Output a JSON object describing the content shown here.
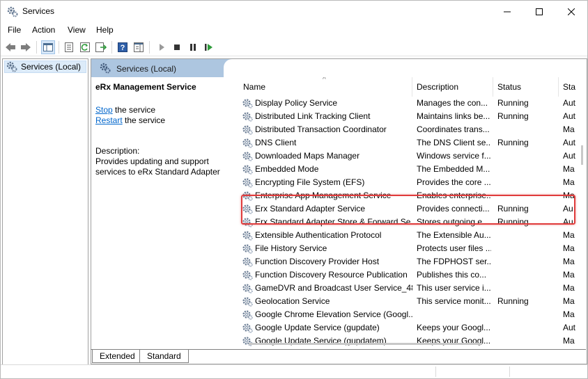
{
  "window": {
    "title": "Services"
  },
  "menu": [
    "File",
    "Action",
    "View",
    "Help"
  ],
  "toolbar": {
    "icons": [
      "back-arrow-icon",
      "forward-arrow-icon",
      "show-hide-console-tree-icon",
      "properties-icon",
      "refresh-icon",
      "export-list-icon",
      "help-icon",
      "show-hide-action-pane-icon",
      "start-service-icon",
      "stop-service-icon",
      "pause-service-icon",
      "restart-service-icon"
    ]
  },
  "tree": {
    "root": "Services (Local)"
  },
  "main": {
    "header": "Services (Local)",
    "selected_title": "eRx Management Service",
    "stop_link": "Stop",
    "stop_suffix": " the service",
    "restart_link": "Restart",
    "restart_suffix": " the service",
    "description_label": "Description:",
    "description_text": "Provides updating and support services to eRx Standard Adapter"
  },
  "columns": {
    "name": "Name",
    "description": "Description",
    "status": "Status",
    "startup": "Sta"
  },
  "services": [
    {
      "name": "Display Policy Service",
      "description": "Manages the con...",
      "status": "Running",
      "startup": "Aut"
    },
    {
      "name": "Distributed Link Tracking Client",
      "description": "Maintains links be...",
      "status": "Running",
      "startup": "Aut"
    },
    {
      "name": "Distributed Transaction Coordinator",
      "description": "Coordinates trans...",
      "status": "",
      "startup": "Ma"
    },
    {
      "name": "DNS Client",
      "description": "The DNS Client se...",
      "status": "Running",
      "startup": "Aut"
    },
    {
      "name": "Downloaded Maps Manager",
      "description": "Windows service f...",
      "status": "",
      "startup": "Aut"
    },
    {
      "name": "Embedded Mode",
      "description": "The Embedded M...",
      "status": "",
      "startup": "Ma"
    },
    {
      "name": "Encrypting File System (EFS)",
      "description": "Provides the core ...",
      "status": "",
      "startup": "Ma"
    },
    {
      "name": "Enterprise App Management Service",
      "description": "Enables enterprise...",
      "status": "",
      "startup": "Ma"
    },
    {
      "name": "Erx Standard Adapter Service",
      "description": "Provides connecti...",
      "status": "Running",
      "startup": "Au"
    },
    {
      "name": "Erx Standard Adapter Store & Forward Se...",
      "description": "Stores outgoing e...",
      "status": "Running",
      "startup": "Au"
    },
    {
      "name": "Extensible Authentication Protocol",
      "description": "The Extensible Au...",
      "status": "",
      "startup": "Ma"
    },
    {
      "name": "File History Service",
      "description": "Protects user files ...",
      "status": "",
      "startup": "Ma"
    },
    {
      "name": "Function Discovery Provider Host",
      "description": "The FDPHOST ser...",
      "status": "",
      "startup": "Ma"
    },
    {
      "name": "Function Discovery Resource Publication",
      "description": "Publishes this co...",
      "status": "",
      "startup": "Ma"
    },
    {
      "name": "GameDVR and Broadcast User Service_48...",
      "description": "This user service i...",
      "status": "",
      "startup": "Ma"
    },
    {
      "name": "Geolocation Service",
      "description": "This service monit...",
      "status": "Running",
      "startup": "Ma"
    },
    {
      "name": "Google Chrome Elevation Service (Googl...",
      "description": "",
      "status": "",
      "startup": "Ma"
    },
    {
      "name": "Google Update Service (gupdate)",
      "description": "Keeps your Googl...",
      "status": "",
      "startup": "Aut"
    },
    {
      "name": "Google Update Service (gupdatem)",
      "description": "Keeps your Googl...",
      "status": "",
      "startup": "Ma"
    }
  ],
  "tabs": [
    "Extended",
    "Standard"
  ],
  "colors": {
    "header_bg": "#adc6e0",
    "highlight": "#e03c3c",
    "link": "#0066cc"
  }
}
